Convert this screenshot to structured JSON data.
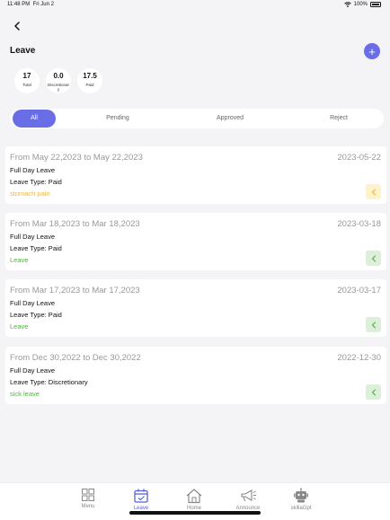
{
  "status": {
    "time": "11:48 PM",
    "date": "Fri Jun 2",
    "battery": "100%"
  },
  "header": {
    "title": "Leave",
    "back_icon": "chevron-left-icon",
    "add_icon": "plus-icon",
    "add_label": "+"
  },
  "stats": [
    {
      "value": "17",
      "label": "Total"
    },
    {
      "value": "0.0",
      "label": "Discretionary"
    },
    {
      "value": "17.5",
      "label": "Paid"
    }
  ],
  "tabs": [
    {
      "label": "All",
      "active": true
    },
    {
      "label": "Pending"
    },
    {
      "label": "Approved"
    },
    {
      "label": "Reject"
    }
  ],
  "colors": {
    "accent": "#6a6ee6",
    "pending": "#e6b84a",
    "approved": "#53b345"
  },
  "leaves": [
    {
      "range": "From May 22,2023 to May 22,2023",
      "date": "2023-05-22",
      "kind": "Full Day Leave",
      "type": "Leave Type: Paid",
      "reason": "stomach pain",
      "status": "pending"
    },
    {
      "range": "From Mar 18,2023 to Mar 18,2023",
      "date": "2023-03-18",
      "kind": "Full Day Leave",
      "type": "Leave Type: Paid",
      "reason": "Leave",
      "status": "approved"
    },
    {
      "range": "From Mar 17,2023 to Mar 17,2023",
      "date": "2023-03-17",
      "kind": "Full Day Leave",
      "type": "Leave Type: Paid",
      "reason": "Leave",
      "status": "approved"
    },
    {
      "range": "From Dec 30,2022 to Dec 30,2022",
      "date": "2022-12-30",
      "kind": "Full Day Leave",
      "type": "Leave Type: Discretionary",
      "reason": "sick leave",
      "status": "approved"
    }
  ],
  "nav": [
    {
      "label": "Menu",
      "icon": "grid-icon"
    },
    {
      "label": "Leave",
      "icon": "calendar-icon",
      "active": true
    },
    {
      "label": "Home",
      "icon": "home-icon"
    },
    {
      "label": "Announce",
      "icon": "megaphone-icon"
    },
    {
      "label": "skillaGpt",
      "icon": "robot-icon"
    }
  ]
}
